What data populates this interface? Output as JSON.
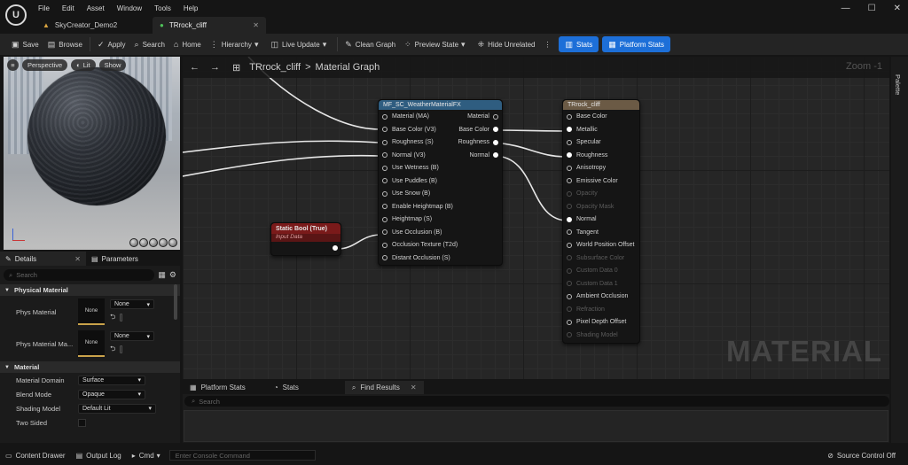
{
  "menu": [
    "File",
    "Edit",
    "Asset",
    "Window",
    "Tools",
    "Help"
  ],
  "doc_tabs": [
    {
      "label": "SkyCreator_Demo2",
      "icon": "level-icon"
    },
    {
      "label": "TRrock_cliff",
      "icon": "material-icon"
    }
  ],
  "toolbar": {
    "save": "Save",
    "browse": "Browse",
    "apply": "Apply",
    "search": "Search",
    "home": "Home",
    "hierarchy": "Hierarchy",
    "live_update": "Live Update",
    "clean_graph": "Clean Graph",
    "preview_state": "Preview State",
    "hide_unrelated": "Hide Unrelated",
    "stats": "Stats",
    "platform_stats": "Platform Stats"
  },
  "viewport": {
    "perspective": "Perspective",
    "lit": "Lit",
    "show": "Show"
  },
  "details": {
    "tab_details": "Details",
    "tab_parameters": "Parameters",
    "search_placeholder": "Search",
    "cat_physical": "Physical Material",
    "phys_material": "Phys Material",
    "phys_material_map": "Phys Material Ma...",
    "none_thumb": "None",
    "none_dd": "None",
    "cat_material": "Material",
    "material_domain": "Material Domain",
    "material_domain_value": "Surface",
    "blend_mode": "Blend Mode",
    "blend_mode_value": "Opaque",
    "shading_model": "Shading Model",
    "shading_model_value": "Default Lit",
    "two_sided": "Two Sided"
  },
  "graph": {
    "breadcrumb_asset": "TRrock_cliff",
    "breadcrumb_sep": ">",
    "breadcrumb_graph": "Material Graph",
    "zoom": "Zoom -1",
    "watermark": "MATERIAL"
  },
  "node_function": {
    "title": "MF_SC_WeatherMaterialFX",
    "inputs": [
      "Material (MA)",
      "Base Color (V3)",
      "Roughness (S)",
      "Normal (V3)",
      "Use Wetness (B)",
      "Use Puddles (B)",
      "Use Snow (B)",
      "Enable Heightmap (B)",
      "Heightmap (S)",
      "Use Occlusion (B)",
      "Occlusion Texture (T2d)",
      "Distant Occlusion (S)"
    ],
    "outputs": [
      "Material",
      "Base Color",
      "Roughness",
      "Normal"
    ]
  },
  "node_static_bool": {
    "title": "Static Bool (True)",
    "subtitle": "Input Data"
  },
  "node_result": {
    "title": "TRrock_cliff",
    "pins": [
      {
        "label": "Base Color",
        "enabled": true
      },
      {
        "label": "Metallic",
        "enabled": true
      },
      {
        "label": "Specular",
        "enabled": true
      },
      {
        "label": "Roughness",
        "enabled": true
      },
      {
        "label": "Anisotropy",
        "enabled": true
      },
      {
        "label": "Emissive Color",
        "enabled": true
      },
      {
        "label": "Opacity",
        "enabled": false
      },
      {
        "label": "Opacity Mask",
        "enabled": false
      },
      {
        "label": "Normal",
        "enabled": true
      },
      {
        "label": "Tangent",
        "enabled": true
      },
      {
        "label": "World Position Offset",
        "enabled": true
      },
      {
        "label": "Subsurface Color",
        "enabled": false
      },
      {
        "label": "Custom Data 0",
        "enabled": false
      },
      {
        "label": "Custom Data 1",
        "enabled": false
      },
      {
        "label": "Ambient Occlusion",
        "enabled": true
      },
      {
        "label": "Refraction",
        "enabled": false
      },
      {
        "label": "Pixel Depth Offset",
        "enabled": true
      },
      {
        "label": "Shading Model",
        "enabled": false
      }
    ]
  },
  "palette": "Palette",
  "bottom_panel": {
    "tabs": [
      "Platform Stats",
      "Stats",
      "Find Results"
    ],
    "search_placeholder": "Search"
  },
  "statusbar": {
    "content_drawer": "Content Drawer",
    "output_log": "Output Log",
    "cmd": "Cmd",
    "console_placeholder": "Enter Console Command",
    "source_control": "Source Control Off"
  },
  "colors": {
    "accent_blue": "#1d6fd8",
    "static_bool_header": "#7a1a1a",
    "function_header": "#2f5d80",
    "result_header": "#6b5a45"
  }
}
